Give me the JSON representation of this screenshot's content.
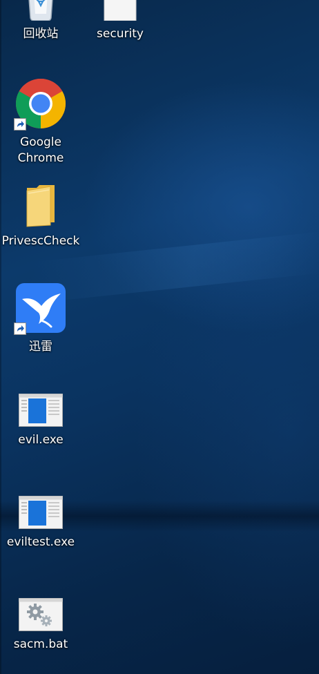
{
  "desktop": {
    "icons": [
      {
        "label": "回收站",
        "icon": "recycle-bin-icon"
      },
      {
        "label": "security",
        "icon": "document-icon"
      },
      {
        "label": "Google Chrome",
        "icon": "chrome-icon",
        "shortcut": true
      },
      {
        "label": "PrivescCheck",
        "icon": "folder-icon"
      },
      {
        "label": "迅雷",
        "icon": "xunlei-icon",
        "shortcut": true
      },
      {
        "label": "evil.exe",
        "icon": "application-window-icon"
      },
      {
        "label": "eviltest.exe",
        "icon": "application-window-icon"
      },
      {
        "label": "sacm.bat",
        "icon": "batch-file-gears-icon"
      }
    ]
  },
  "colors": {
    "background": "#0c3a6b",
    "label_text": "#ffffff",
    "xunlei_blue": "#2f7df6",
    "folder_yellow": "#f2cd6b"
  }
}
